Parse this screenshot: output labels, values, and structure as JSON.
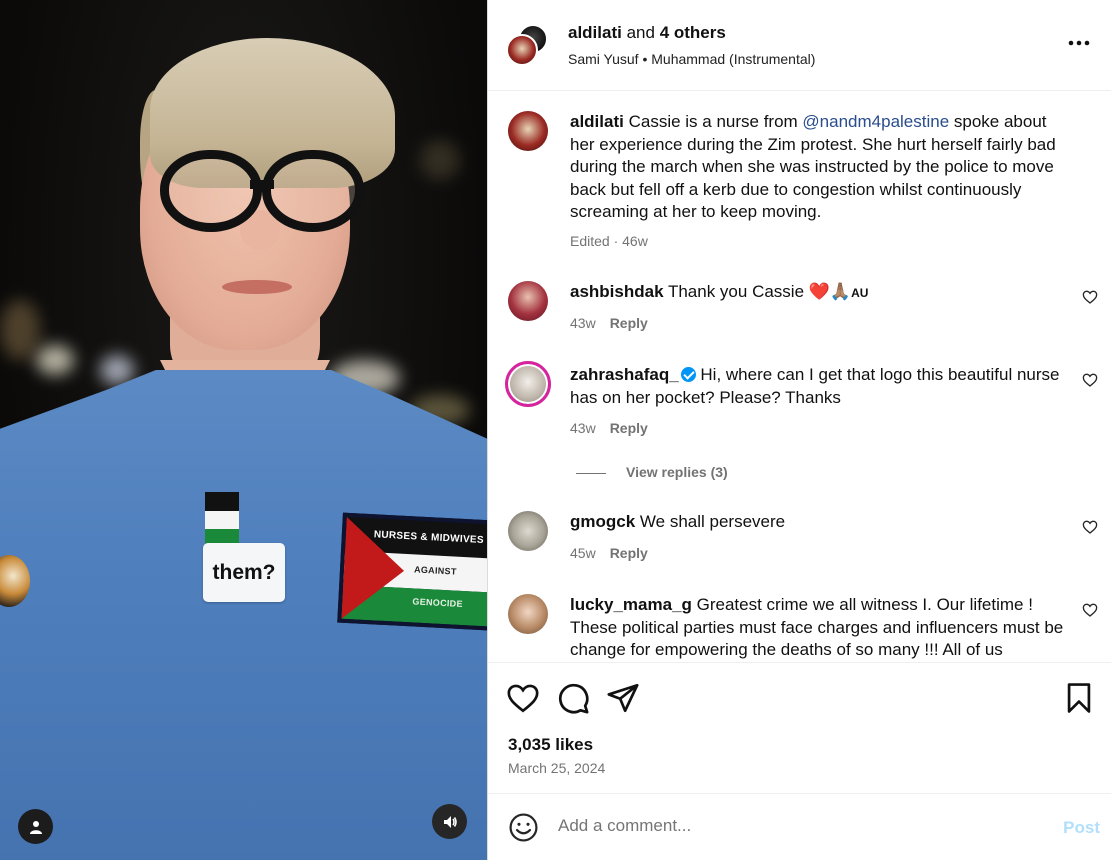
{
  "header": {
    "username": "aldilati",
    "others": "and",
    "others_count": "4 others",
    "audio": "Sami Yusuf • Muhammad (Instrumental)",
    "more_icon": "more-icon"
  },
  "media": {
    "sticker_text": "them?",
    "patch_line1": "NURSES & MIDWIVES",
    "patch_line2": "AGAINST",
    "patch_line3": "GENOCIDE"
  },
  "caption": {
    "user": "aldilati",
    "text_before": " Cassie is a nurse from ",
    "mention": "@nandm4palestine",
    "text_after": " spoke about her experience during the Zim protest. She hurt herself fairly bad during the march when she was instructed by the police to move back but fell off a kerb due to congestion whilst continuously screaming at her to keep moving.",
    "meta": "Edited · 46w"
  },
  "comments": [
    {
      "user": "ashbishdak",
      "text": " Thank you Cassie ❤️🙏🏽",
      "suffix": "AU",
      "time": "43w",
      "reply": "Reply",
      "verified": false
    },
    {
      "user": "zahrashafaq_",
      "text": " Hi, where can I get that logo this beautiful nurse has on her pocket? Please? Thanks",
      "time": "43w",
      "reply": "Reply",
      "verified": true
    },
    {
      "user": "gmogck",
      "text": " We shall persevere",
      "time": "45w",
      "reply": "Reply",
      "verified": false
    },
    {
      "user": "lucky_mama_g",
      "text": " Greatest crime we all witness I. Our lifetime ! These political parties must face charges and influencers must be change for empowering the deaths of so many !!! All of us",
      "verified": false
    }
  ],
  "view_replies": "View replies (3)",
  "likes": "3,035 likes",
  "date": "March 25, 2024",
  "add_comment": {
    "placeholder": "Add a comment...",
    "post": "Post"
  },
  "colors": {
    "accent": "#0095f6",
    "muted": "#737373",
    "post_disabled": "#b2dffc"
  }
}
